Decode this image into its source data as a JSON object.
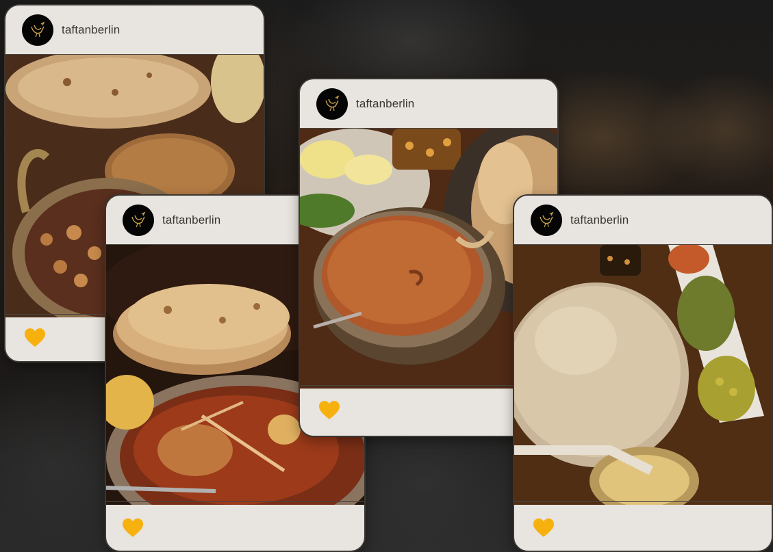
{
  "posts": [
    {
      "username": "taftanberlin"
    },
    {
      "username": "taftanberlin"
    },
    {
      "username": "taftanberlin"
    },
    {
      "username": "taftanberlin"
    }
  ],
  "colors": {
    "card": "#e8e4df",
    "heart": "#f7b10f",
    "avatar": "#050505",
    "logo": "#c9a24a"
  },
  "icons": {
    "avatar": "bird-logo-icon",
    "like": "heart-icon"
  }
}
